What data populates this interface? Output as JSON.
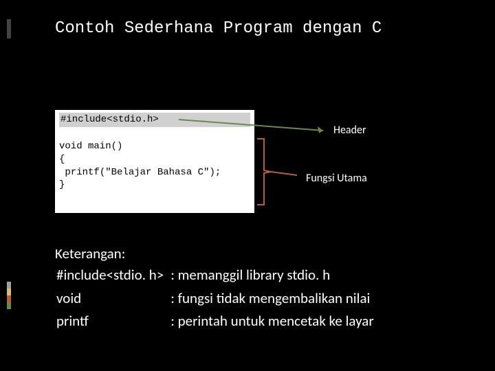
{
  "title": "Contoh Sederhana Program dengan C",
  "code": {
    "line_include": "#include<stdio.h>",
    "line_main": "void main()",
    "line_open": "{",
    "line_printf": "printf(\"Belajar Bahasa C\");",
    "line_close": "}"
  },
  "labels": {
    "header": "Header",
    "fungsi": "Fungsi Utama"
  },
  "keterangan": {
    "heading": "Keterangan:",
    "rows": [
      {
        "term": "#include<stdio. h>",
        "desc": ": memanggil library stdio. h"
      },
      {
        "term": "void",
        "desc": ": fungsi tidak mengembalikan nilai"
      },
      {
        "term": "printf",
        "desc": ": perintah untuk mencetak ke layar"
      }
    ]
  }
}
